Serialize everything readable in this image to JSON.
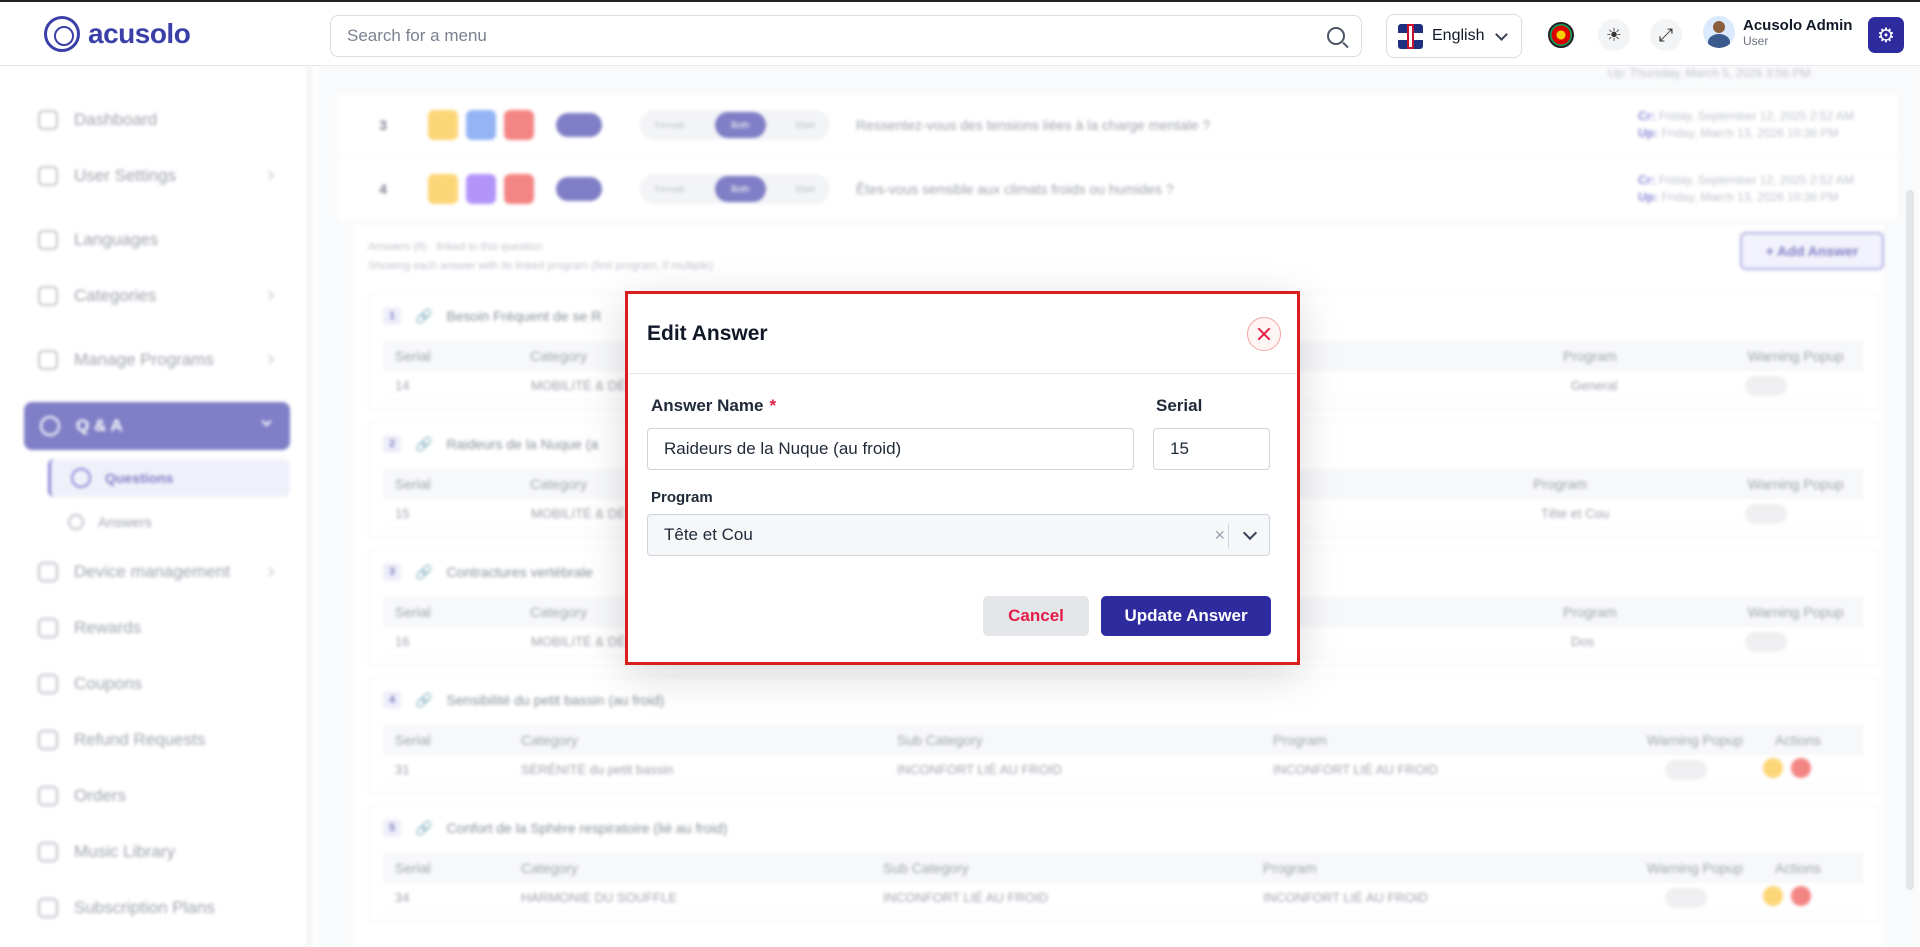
{
  "header": {
    "logo_text": "acusolo",
    "search_placeholder": "Search for a menu",
    "language": "English",
    "user_name": "Acusolo Admin",
    "user_role": "User"
  },
  "sidebar": {
    "items": [
      {
        "label": "Dashboard"
      },
      {
        "label": "User Settings"
      },
      {
        "label": "Languages"
      },
      {
        "label": "Categories"
      },
      {
        "label": "Manage Programs"
      },
      {
        "label": "Q & A"
      },
      {
        "label": "Device management"
      },
      {
        "label": "Rewards"
      },
      {
        "label": "Coupons"
      },
      {
        "label": "Refund Requests"
      },
      {
        "label": "Orders"
      },
      {
        "label": "Music Library"
      },
      {
        "label": "Subscription Plans"
      }
    ],
    "sub_items": [
      {
        "label": "Questions"
      },
      {
        "label": "Answers"
      }
    ]
  },
  "questions": [
    {
      "num": "3",
      "seg": [
        "Female",
        "Both",
        "Male"
      ],
      "text": "Ressentez-vous des tensions liées à la charge mentale ?",
      "created_label": "Cr:",
      "created": "Friday, September 12, 2025 2:52 AM",
      "updated_label": "Up:",
      "updated": "Friday, March 13, 2026 10:36 PM"
    },
    {
      "num": "4",
      "seg": [
        "Female",
        "Both",
        "Male"
      ],
      "text": "Êtes-vous sensible aux climats froids ou humides ?",
      "created_label": "Cr:",
      "created": "Friday, September 12, 2025 2:52 AM",
      "updated_label": "Up:",
      "updated": "Friday, March 13, 2026 10:36 PM"
    }
  ],
  "top_partial_date": "Up: Thursday, March 5, 2026 3:56 PM",
  "answers_panel": {
    "info_line1": "Answers (8) · linked to this question",
    "info_line2": "Showing each answer with its linked program (first program, if multiple)",
    "add_button": "+ Add Answer",
    "columns": [
      "Serial",
      "Category",
      "Sub Category",
      "Program",
      "Warning Popup",
      "Actions"
    ],
    "cards": [
      {
        "num": "1",
        "title": "Besoin Fréquent de se R",
        "serial": "14",
        "category": "MOBILITÉ & DÉ",
        "subcategory": "",
        "program": "General"
      },
      {
        "num": "2",
        "title": "Raideurs de la Nuque (a",
        "serial": "15",
        "category": "MOBILITÉ & DÉ",
        "subcategory": "",
        "program": "Tête et Cou"
      },
      {
        "num": "3",
        "title": "Contractures vertébrale",
        "serial": "16",
        "category": "MOBILITÉ & DÉ",
        "subcategory": "",
        "program": "Dos"
      },
      {
        "num": "4",
        "title": "Sensibilité du petit bassin (au froid)",
        "serial": "31",
        "category": "SÉRÉNITÉ du petit bassin",
        "subcategory": "INCONFORT LIÉ AU FROID",
        "program": "INCONFORT LIÉ AU FROID"
      },
      {
        "num": "5",
        "title": "Confort de la Sphère respiratoire (lié au froid)",
        "serial": "34",
        "category": "HARMONIE DU SOUFFLE",
        "subcategory": "INCONFORT LIÉ AU FROID",
        "program": "INCONFORT LIÉ AU FROID"
      }
    ]
  },
  "modal": {
    "title": "Edit Answer",
    "answer_name_label": "Answer Name",
    "required_mark": "*",
    "answer_name_value": "Raideurs de la Nuque (au froid)",
    "serial_label": "Serial",
    "serial_value": "15",
    "program_label": "Program",
    "program_value": "Tête et Cou",
    "cancel_label": "Cancel",
    "update_label": "Update Answer"
  },
  "colors": {
    "primary": "#2d2b9e",
    "danger": "#e11d48",
    "modal_border": "#d91e1e"
  }
}
